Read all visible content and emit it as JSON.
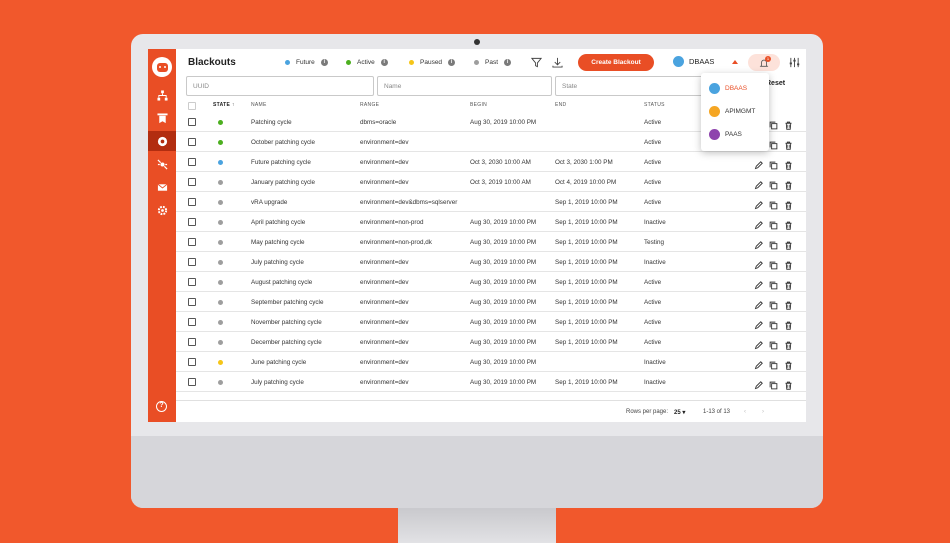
{
  "app": {
    "title": "Blackouts"
  },
  "legend": [
    {
      "label": "Future",
      "color": "#4aa3df"
    },
    {
      "label": "Active",
      "color": "#4caf1f"
    },
    {
      "label": "Paused",
      "color": "#f5c518"
    },
    {
      "label": "Past",
      "color": "#9e9e9e"
    }
  ],
  "toolbar": {
    "create_label": "Create Blackout",
    "tenant_label": "DBAAS",
    "notification_count": "1"
  },
  "filters": {
    "uuid_placeholder": "UUID",
    "name_placeholder": "Name",
    "state_placeholder": "State",
    "reset_label": "Reset"
  },
  "table": {
    "headers": {
      "state": "STATE ↑",
      "name": "NAME",
      "range": "RANGE",
      "begin": "BEGIN",
      "end": "END",
      "status": "STATUS"
    },
    "rows": [
      {
        "state": "Active",
        "name": "Patching cycle",
        "range": "dbms=oracle",
        "begin": "Aug 30, 2019 10:00 PM",
        "end": "",
        "status": "Active"
      },
      {
        "state": "Active",
        "name": "October patching cycle",
        "range": "environment=dev",
        "begin": "",
        "end": "",
        "status": "Active"
      },
      {
        "state": "Future",
        "name": "Future patching cycle",
        "range": "environment=dev",
        "begin": "Oct 3, 2030 10:00 AM",
        "end": "Oct 3, 2030 1:00 PM",
        "status": "Active"
      },
      {
        "state": "Past",
        "name": "January patching cycle",
        "range": "environment=dev",
        "begin": "Oct 3, 2019 10:00 AM",
        "end": "Oct 4, 2019 10:00 PM",
        "status": "Active"
      },
      {
        "state": "Past",
        "name": "vRA upgrade",
        "range": "environment=dev&dbms=sqlserver",
        "begin": "",
        "end": "Sep 1, 2019 10:00 PM",
        "status": "Active"
      },
      {
        "state": "Past",
        "name": "April patching cycle",
        "range": "environment=non-prod",
        "begin": "Aug 30, 2019 10:00 PM",
        "end": "Sep 1, 2019 10:00 PM",
        "status": "Inactive"
      },
      {
        "state": "Past",
        "name": "May patching cycle",
        "range": "environment=non-prod,dk",
        "begin": "Aug 30, 2019 10:00 PM",
        "end": "Sep 1, 2019 10:00 PM",
        "status": "Testing"
      },
      {
        "state": "Past",
        "name": "July patching cycle",
        "range": "environment=dev",
        "begin": "Aug 30, 2019 10:00 PM",
        "end": "Sep 1, 2019 10:00 PM",
        "status": "Inactive"
      },
      {
        "state": "Past",
        "name": "August patching cycle",
        "range": "environment=dev",
        "begin": "Aug 30, 2019 10:00 PM",
        "end": "Sep 1, 2019 10:00 PM",
        "status": "Active"
      },
      {
        "state": "Past",
        "name": "September patching cycle",
        "range": "environment=dev",
        "begin": "Aug 30, 2019 10:00 PM",
        "end": "Sep 1, 2019 10:00 PM",
        "status": "Active"
      },
      {
        "state": "Past",
        "name": "November patching cycle",
        "range": "environment=dev",
        "begin": "Aug 30, 2019 10:00 PM",
        "end": "Sep 1, 2019 10:00 PM",
        "status": "Active"
      },
      {
        "state": "Past",
        "name": "December patching cycle",
        "range": "environment=dev",
        "begin": "Aug 30, 2019 10:00 PM",
        "end": "Sep 1, 2019 10:00 PM",
        "status": "Active"
      },
      {
        "state": "Paused",
        "name": "June patching cycle",
        "range": "environment=dev",
        "begin": "Aug 30, 2019 10:00 PM",
        "end": "",
        "status": "Inactive"
      },
      {
        "state": "Past",
        "name": "July patching cycle",
        "range": "environment=dev",
        "begin": "Aug 30, 2019 10:00 PM",
        "end": "Sep 1, 2019 10:00 PM",
        "status": "Inactive"
      }
    ]
  },
  "pagination": {
    "rows_label": "Rows per page:",
    "rows_value": "25",
    "range_label": "1-13 of 13"
  },
  "tenant_dropdown": [
    {
      "label": "DBAAS",
      "color": "#4aa3df"
    },
    {
      "label": "APIMGMT",
      "color": "#f5a623"
    },
    {
      "label": "PAAS",
      "color": "#8e44ad"
    }
  ],
  "colors": {
    "accent": "#e94e25",
    "background": "#f1582c"
  }
}
